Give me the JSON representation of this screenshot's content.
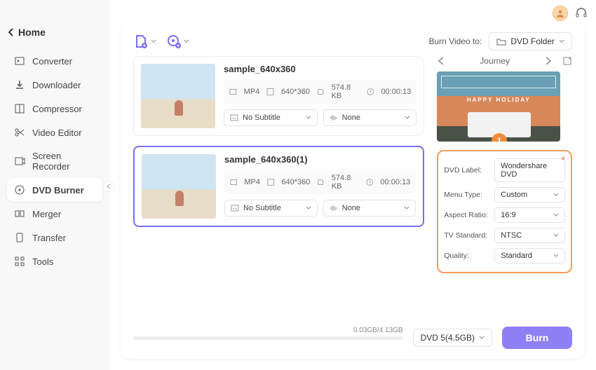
{
  "window": {
    "home": "Home"
  },
  "sidebar": {
    "items": [
      {
        "label": "Converter"
      },
      {
        "label": "Downloader"
      },
      {
        "label": "Compressor"
      },
      {
        "label": "Video Editor"
      },
      {
        "label": "Screen Recorder"
      },
      {
        "label": "DVD Burner"
      },
      {
        "label": "Merger"
      },
      {
        "label": "Transfer"
      },
      {
        "label": "Tools"
      }
    ]
  },
  "header": {
    "burnVideoTo": "Burn Video to:",
    "burnTarget": "DVD Folder"
  },
  "files": [
    {
      "name": "sample_640x360",
      "format": "MP4",
      "resolution": "640*360",
      "size": "574.8 KB",
      "duration": "00:00:13",
      "subtitle": "No Subtitle",
      "audio": "None"
    },
    {
      "name": "sample_640x360(1)",
      "format": "MP4",
      "resolution": "640*360",
      "size": "574.8 KB",
      "duration": "00:00:13",
      "subtitle": "No Subtitle",
      "audio": "None"
    }
  ],
  "template": {
    "name": "Journey",
    "preview_text": "HAPPY HOLIDAY",
    "badge": "1"
  },
  "settings": {
    "dvdLabel_label": "DVD Label:",
    "dvdLabel_value": "Wondershare DVD",
    "menuType_label": "Menu Type:",
    "menuType_value": "Custom",
    "aspect_label": "Aspect Ratio:",
    "aspect_value": "16:9",
    "tv_label": "TV Standard:",
    "tv_value": "NTSC",
    "quality_label": "Quality:",
    "quality_value": "Standard"
  },
  "footer": {
    "usage": "0.03GB/4.13GB",
    "disc": "DVD 5(4.5GB)",
    "burn": "Burn"
  }
}
